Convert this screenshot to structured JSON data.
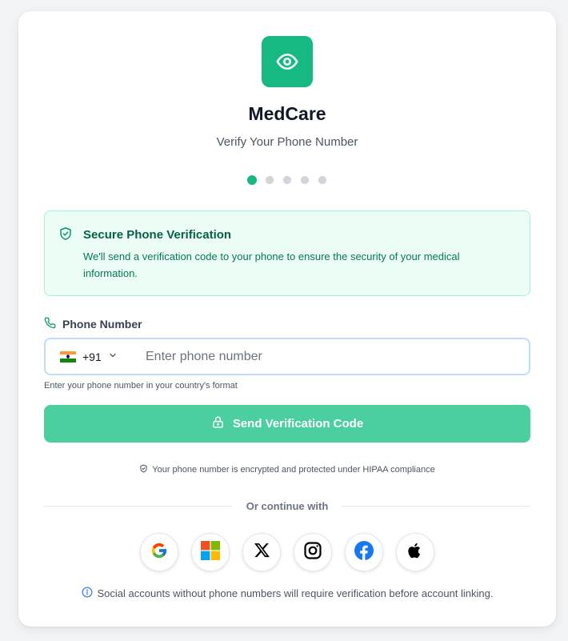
{
  "brand": {
    "name": "MedCare",
    "subtitle": "Verify Your Phone Number"
  },
  "steps": {
    "total": 5,
    "current": 1
  },
  "notice": {
    "title": "Secure Phone Verification",
    "text": "We'll send a verification code to your phone to ensure the security of your medical information."
  },
  "phone": {
    "label": "Phone Number",
    "country_code": "+91",
    "country_flag": "india-flag",
    "placeholder": "Enter phone number",
    "value": "",
    "hint": "Enter your phone number in your country's format"
  },
  "send_button": {
    "label": "Send Verification Code"
  },
  "hipaa_note": "Your phone number is encrypted and protected under HIPAA compliance",
  "divider_text": "Or continue with",
  "social_providers": [
    "google",
    "microsoft",
    "x",
    "instagram",
    "facebook",
    "apple"
  ],
  "social_note": "Social accounts without phone numbers will require verification before account linking.",
  "colors": {
    "brand": "#16b981",
    "button": "#4ccf9f",
    "notice_bg": "#ecfdf5",
    "notice_border": "#a7f3d0",
    "input_border": "#bfdbfe"
  }
}
